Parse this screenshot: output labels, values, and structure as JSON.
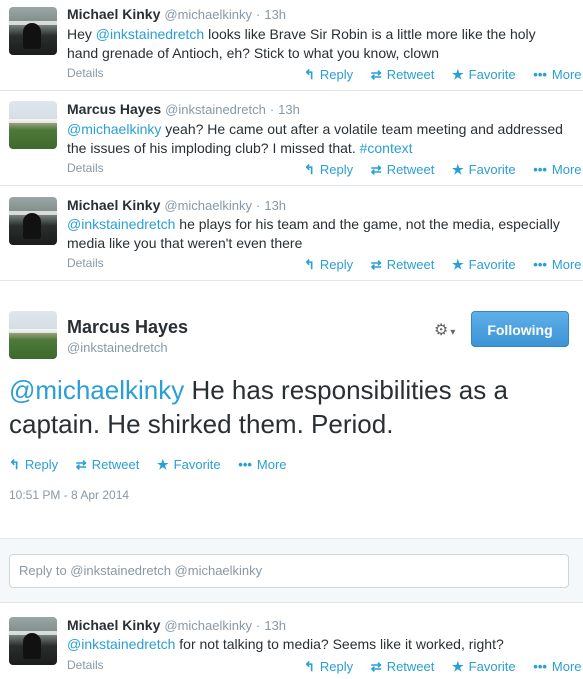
{
  "tweets": [
    {
      "name": "Michael Kinky",
      "handle": "@michaelkinky",
      "time": "13h",
      "text_parts": [
        "Hey ",
        "@inkstainedretch",
        " looks like Brave Sir Robin is a little more like the holy",
        "hand grenade of Antioch, eh? Stick to what you know, clown"
      ],
      "details": "Details"
    },
    {
      "name": "Marcus Hayes",
      "handle": "@inkstainedretch",
      "time": "13h",
      "text_parts": [
        "@michaelkinky",
        " yeah? He came out after a volatile team meeting and addressed",
        "the issues of his imploding club? I missed that. ",
        "#context"
      ],
      "details": "Details"
    },
    {
      "name": "Michael Kinky",
      "handle": "@michaelkinky",
      "time": "13h",
      "text_parts": [
        "@inkstainedretch",
        " he plays for his team and the game, not the media, especially",
        "media like you that weren't even there"
      ],
      "details": "Details"
    },
    {
      "name": "Michael Kinky",
      "handle": "@michaelkinky",
      "time": "13h",
      "text_parts": [
        "@inkstainedretch",
        " for not talking to media? Seems like it worked, right?"
      ],
      "details": "Details"
    }
  ],
  "actions": {
    "reply": "Reply",
    "retweet": "Retweet",
    "favorite": "Favorite",
    "more": "More"
  },
  "focused": {
    "name": "Marcus Hayes",
    "handle": "@inkstainedretch",
    "follow_label": "Following",
    "text_mention": "@michaelkinky",
    "text_line1": " He has responsibilities as a",
    "text_line2": "captain. He shirked them. Period.",
    "timestamp": "10:51 PM - 8 Apr 2014"
  },
  "reply_box": {
    "placeholder": "Reply to @inkstainedretch @michaelkinky"
  },
  "colors": {
    "link": "#2a9fd6",
    "muted": "#8899a6",
    "follow_button": "#4aa3df"
  },
  "icons": {
    "reply": "reply-arrow-icon",
    "retweet": "retweet-icon",
    "favorite": "star-icon",
    "more": "ellipsis-icon",
    "settings": "gear-icon"
  }
}
